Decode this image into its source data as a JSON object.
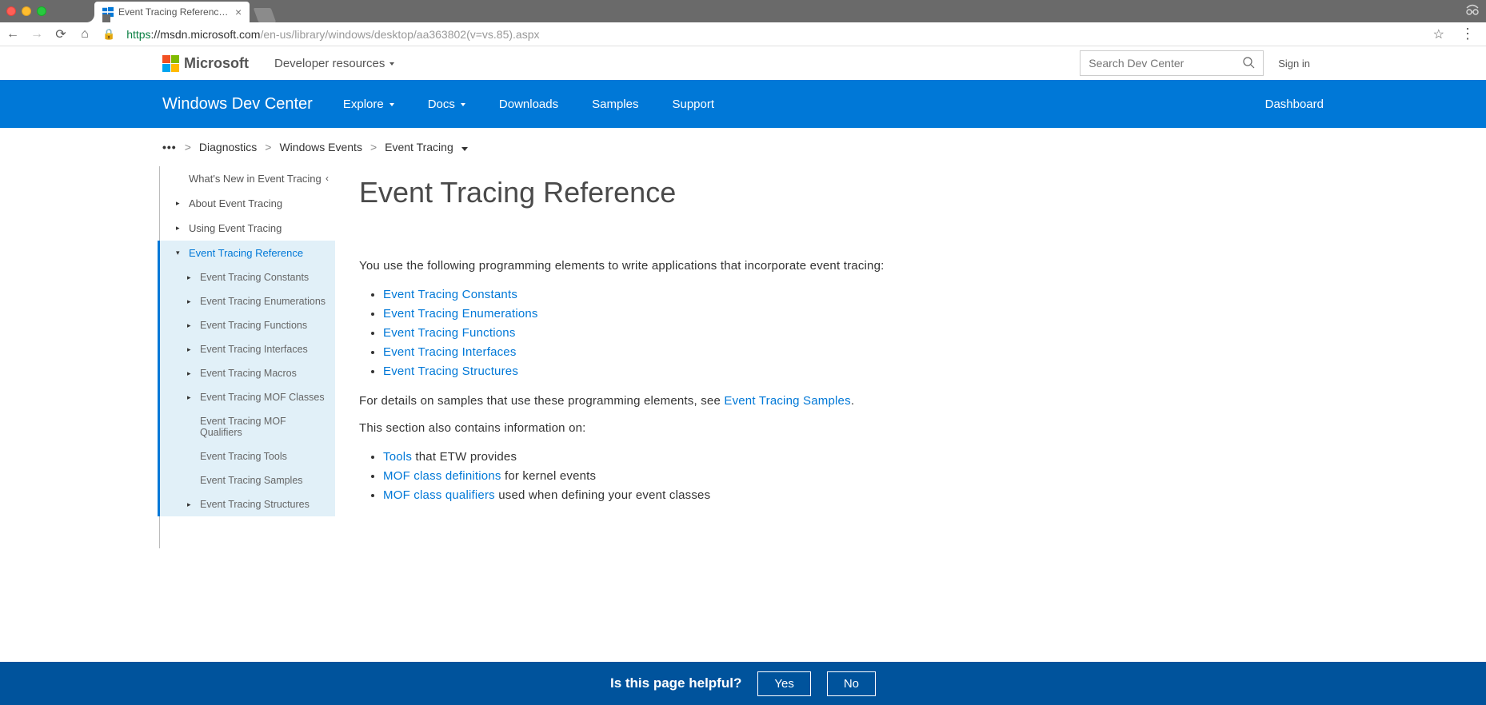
{
  "browser": {
    "tab_title": "Event Tracing Reference (Wind",
    "url_scheme": "https",
    "url_host": "://msdn.microsoft.com",
    "url_path": "/en-us/library/windows/desktop/aa363802(v=vs.85).aspx"
  },
  "ms_header": {
    "brand": "Microsoft",
    "dev_resources": "Developer resources",
    "search_placeholder": "Search Dev Center",
    "signin": "Sign in"
  },
  "blue_nav": {
    "brand": "Windows Dev Center",
    "items": [
      "Explore",
      "Docs",
      "Downloads",
      "Samples",
      "Support"
    ],
    "dashboard": "Dashboard"
  },
  "breadcrumb": {
    "ellipsis": "•••",
    "items": [
      "Diagnostics",
      "Windows Events",
      "Event Tracing"
    ]
  },
  "sidebar": {
    "whats_new": "What's New in Event Tracing",
    "about": "About Event Tracing",
    "using": "Using Event Tracing",
    "ref": "Event Tracing Reference",
    "children": [
      "Event Tracing Constants",
      "Event Tracing Enumerations",
      "Event Tracing Functions",
      "Event Tracing Interfaces",
      "Event Tracing Macros",
      "Event Tracing MOF Classes",
      "Event Tracing MOF Qualifiers",
      "Event Tracing Tools",
      "Event Tracing Samples",
      "Event Tracing Structures"
    ]
  },
  "content": {
    "title": "Event Tracing Reference",
    "intro": "You use the following programming elements to write applications that incorporate event tracing:",
    "links1": [
      "Event Tracing Constants",
      "Event Tracing Enumerations",
      "Event Tracing Functions",
      "Event Tracing Interfaces",
      "Event Tracing Structures"
    ],
    "p2_a": "For details on samples that use these programming elements, see ",
    "p2_link": "Event Tracing Samples",
    "p2_b": ".",
    "p3": "This section also contains information on:",
    "list2": [
      {
        "link": "Tools",
        "rest": " that ETW provides"
      },
      {
        "link": "MOF class definitions",
        "rest": " for kernel events"
      },
      {
        "link": "MOF class qualifiers",
        "rest": " used when defining your event classes"
      }
    ]
  },
  "feedback": {
    "question": "Is this page helpful?",
    "yes": "Yes",
    "no": "No"
  }
}
